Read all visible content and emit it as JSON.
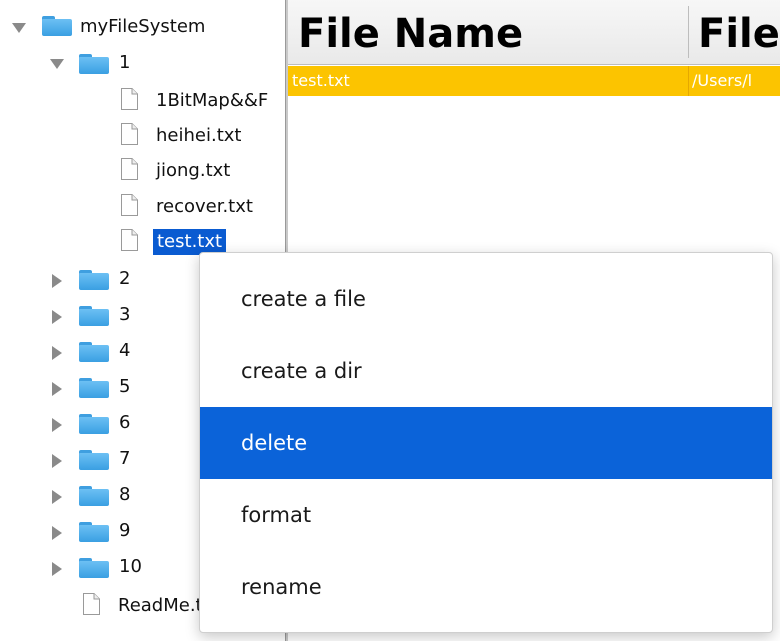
{
  "tree": {
    "root": {
      "label": "myFileSystem",
      "expanded": true
    },
    "folder1": {
      "label": "1",
      "expanded": true,
      "files": [
        "1BitMap&&F",
        "heihei.txt",
        "jiong.txt",
        "recover.txt",
        "test.txt"
      ],
      "selected_file": "test.txt"
    },
    "folders": [
      "2",
      "3",
      "4",
      "5",
      "6",
      "7",
      "8",
      "9",
      "10"
    ],
    "root_files": [
      "ReadMe.txt"
    ]
  },
  "table": {
    "columns": [
      "File Name",
      "File"
    ],
    "rows": [
      [
        "test.txt",
        "/Users/l"
      ]
    ],
    "selected_row_color": "#fcc400"
  },
  "context_menu": {
    "items": [
      "create a file",
      "create a dir",
      "delete",
      "format",
      "rename"
    ],
    "highlighted": "delete",
    "highlight_color": "#0b63d9"
  },
  "icons": {
    "expanded": "triangle-down-icon",
    "collapsed": "triangle-right-icon",
    "folder": "folder-icon",
    "file": "file-icon"
  }
}
